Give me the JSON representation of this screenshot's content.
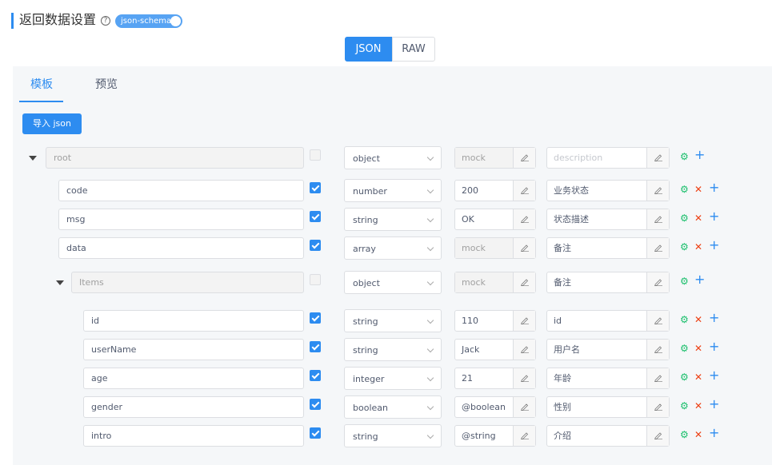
{
  "header": {
    "title": "返回数据设置",
    "help_icon": "help-circle-icon",
    "switch_label": "json-schema",
    "switch_on": true
  },
  "mode": {
    "json_label": "JSON",
    "raw_label": "RAW",
    "active": "JSON"
  },
  "tabs": [
    {
      "label": "模板",
      "active": true
    },
    {
      "label": "预览",
      "active": false
    }
  ],
  "import_button": "导入 json",
  "rows": [
    {
      "name": "root",
      "level": 0,
      "expandable": true,
      "name_disabled": true,
      "required": false,
      "required_disabled": true,
      "type": "object",
      "mock": "mock",
      "mock_disabled": true,
      "description": "description",
      "description_placeholder": true,
      "deletable": false
    },
    {
      "name": "code",
      "level": 1,
      "required": true,
      "type": "number",
      "mock": "200",
      "description": "业务状态",
      "deletable": true
    },
    {
      "name": "msg",
      "level": 1,
      "required": true,
      "type": "string",
      "mock": "OK",
      "description": "状态描述",
      "deletable": true
    },
    {
      "name": "data",
      "level": 1,
      "required": true,
      "type": "array",
      "mock": "mock",
      "mock_disabled": true,
      "description": "备注",
      "deletable": true
    },
    {
      "name": "Items",
      "level": 2,
      "expandable": true,
      "name_disabled": true,
      "required": false,
      "required_disabled": true,
      "type": "object",
      "mock": "mock",
      "mock_disabled": true,
      "description": "备注",
      "deletable": false
    },
    {
      "name": "id",
      "level": 3,
      "required": true,
      "type": "string",
      "mock": "110",
      "description": "id",
      "deletable": true
    },
    {
      "name": "userName",
      "level": 3,
      "required": true,
      "type": "string",
      "mock": "Jack",
      "description": "用户名",
      "deletable": true
    },
    {
      "name": "age",
      "level": 3,
      "required": true,
      "type": "integer",
      "mock": "21",
      "description": "年龄",
      "deletable": true
    },
    {
      "name": "gender",
      "level": 3,
      "required": true,
      "type": "boolean",
      "mock": "@boolean",
      "description": "性别",
      "deletable": true
    },
    {
      "name": "intro",
      "level": 3,
      "required": true,
      "type": "string",
      "mock": "@string",
      "description": "介绍",
      "deletable": true
    }
  ],
  "icons": {
    "settings": "gear-icon",
    "delete": "close-icon",
    "add": "plus-icon",
    "edit": "pencil-icon",
    "expand": "caret-down-icon"
  },
  "colors": {
    "primary": "#2d8cf0",
    "success": "#19be6b",
    "danger": "#ed4014"
  }
}
